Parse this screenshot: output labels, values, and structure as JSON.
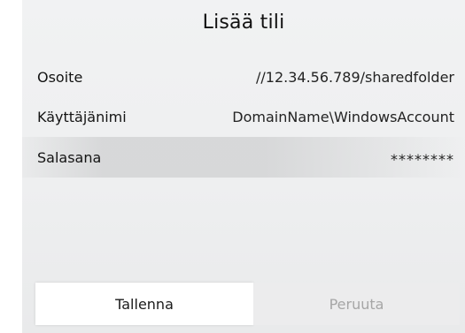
{
  "dialog": {
    "title": "Lisää tili",
    "fields": {
      "address": {
        "label": "Osoite",
        "value": "//12.34.56.789/sharedfolder"
      },
      "username": {
        "label": "Käyttäjänimi",
        "value": "DomainName\\WindowsAccount"
      },
      "password": {
        "label": "Salasana",
        "value": "********"
      }
    },
    "buttons": {
      "save": "Tallenna",
      "cancel": "Peruuta"
    }
  },
  "colors": {
    "background": "#eeeff0",
    "focused_row": "#d6d7d8",
    "button_active": "#ffffff",
    "button_inactive_text": "#a6a6a6"
  }
}
